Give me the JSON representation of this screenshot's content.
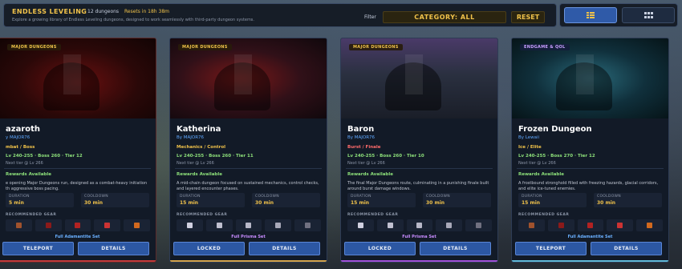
{
  "header": {
    "title": "ENDLESS LEVELING",
    "count": "12 dungeons",
    "reset_timer": "Resets in 18h 38m",
    "subtitle": "Explore a growing library of Endless Leveling dungeons, designed to work seamlessly with third-party dungeon systems.",
    "filter_label": "Filter",
    "category_value": "CATEGORY: ALL",
    "reset_label": "RESET"
  },
  "view_toggle": {
    "list_icon": "list-icon",
    "grid_icon": "grid-icon",
    "active": "list"
  },
  "labels": {
    "duration": "DURATION",
    "cooldown": "COOLDOWN",
    "recommended_gear": "RECOMMENDED GEAR",
    "rewards": "Rewards Available"
  },
  "cards": [
    {
      "badge": "MAJOR DUNGEONS",
      "name": "azaroth",
      "author": "y MAJOR76",
      "tags": "mbat / Boss",
      "stats": "Lv 240-255 · Boss 260 · Tier 12",
      "next_tier": "Next tier @ Lv 266",
      "desc": "e opening Major Dungeons run, designed as a combat-heavy initiation th aggressive boss pacing.",
      "duration": "5 min",
      "cooldown": "30 min",
      "gear_set": "Full Adamantite Set",
      "btn_left": "TELEPORT",
      "btn_right": "DETAILS",
      "accent": "#c23a3a",
      "tag_color": "#f0c24a",
      "set_color": "#6ab0ff"
    },
    {
      "badge": "MAJOR DUNGEONS",
      "name": "Katherina",
      "author": "By MAJOR76",
      "tags": "Mechanics / Control",
      "stats": "Lv 240-255 · Boss 260 · Tier 11",
      "next_tier": "Next tier @ Lv 266",
      "desc": "A mid-chain dungeon focused on sustained mechanics, control checks, and layered encounter phases.",
      "duration": "15 min",
      "cooldown": "30 min",
      "gear_set": "Full Prisma Set",
      "btn_left": "LOCKED",
      "btn_right": "DETAILS",
      "accent": "#d2a24a",
      "tag_color": "#f0c24a",
      "set_color": "#c88cff"
    },
    {
      "badge": "MAJOR DUNGEONS",
      "name": "Baron",
      "author": "By MAJOR76",
      "tags": "Burst / Finale",
      "stats": "Lv 240-255 · Boss 260 · Tier 10",
      "next_tier": "Next tier @ Lv 266",
      "desc": "The final Major Dungeons route, culminating in a punishing finale built around burst damage windows.",
      "duration": "15 min",
      "cooldown": "30 min",
      "gear_set": "Full Prisma Set",
      "btn_left": "LOCKED",
      "btn_right": "DETAILS",
      "accent": "#a050d8",
      "tag_color": "#ff6b6b",
      "set_color": "#c88cff"
    },
    {
      "badge": "ENDGAME & QOL",
      "name": "Frozen Dungeon",
      "author": "By Lewaii",
      "tags": "Ice / Elite",
      "stats": "Lv 240-255 · Boss 270 · Tier 12",
      "next_tier": "Next tier @ Lv 266",
      "desc": "A frostbound stronghold filled with freezing hazards, glacial corridors, and elite ice-tuned enemies.",
      "duration": "15 min",
      "cooldown": "30 min",
      "gear_set": "Full Adamantite Set",
      "btn_left": "TELEPORT",
      "btn_right": "DETAILS",
      "accent": "#5fb8d8",
      "tag_color": "#f0c24a",
      "set_color": "#6ab0ff"
    }
  ]
}
